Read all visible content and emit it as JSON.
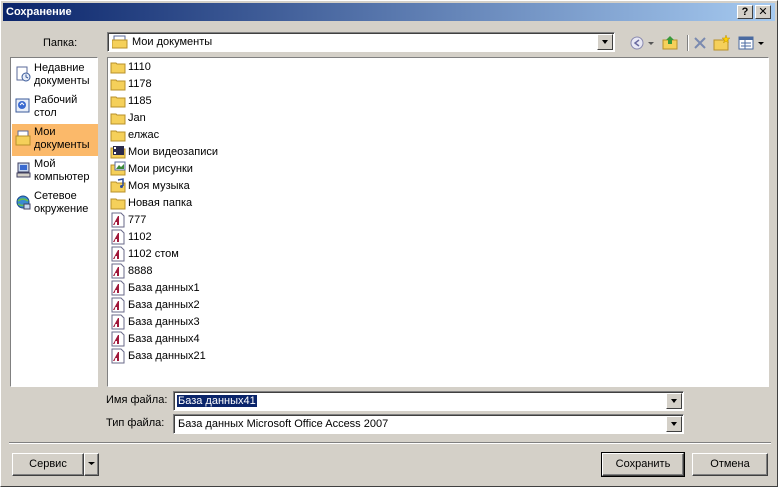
{
  "window": {
    "title": "Сохранение",
    "help_label": "?",
    "close_label": "✕"
  },
  "folder": {
    "label": "Папка:",
    "current": "Мои документы"
  },
  "places": [
    {
      "label": "Недавние\nдокументы",
      "icon": "recent-documents-icon",
      "selected": false
    },
    {
      "label": "Рабочий\nстол",
      "icon": "desktop-icon",
      "selected": false
    },
    {
      "label": "Мои\nдокументы",
      "icon": "my-documents-icon",
      "selected": true
    },
    {
      "label": "Мой\nкомпьютер",
      "icon": "my-computer-icon",
      "selected": false
    },
    {
      "label": "Сетевое\nокружение",
      "icon": "network-icon",
      "selected": false
    }
  ],
  "files": [
    {
      "name": "1110",
      "icon": "folder-icon"
    },
    {
      "name": "1178",
      "icon": "folder-icon"
    },
    {
      "name": "1185",
      "icon": "folder-icon"
    },
    {
      "name": "Jan",
      "icon": "folder-icon"
    },
    {
      "name": "елжас",
      "icon": "folder-icon"
    },
    {
      "name": "Мои видеозаписи",
      "icon": "video-folder-icon"
    },
    {
      "name": "Мои рисунки",
      "icon": "pictures-folder-icon"
    },
    {
      "name": "Моя музыка",
      "icon": "music-folder-icon"
    },
    {
      "name": "Новая папка",
      "icon": "folder-icon"
    },
    {
      "name": "777",
      "icon": "access-db-icon"
    },
    {
      "name": "1102",
      "icon": "access-db-icon"
    },
    {
      "name": "1102 стом",
      "icon": "access-db-icon"
    },
    {
      "name": "8888",
      "icon": "access-db-icon"
    },
    {
      "name": "База данных1",
      "icon": "access-db-icon"
    },
    {
      "name": "База данных2",
      "icon": "access-db-icon"
    },
    {
      "name": "База данных3",
      "icon": "access-db-icon"
    },
    {
      "name": "База данных4",
      "icon": "access-db-icon"
    },
    {
      "name": "База данных21",
      "icon": "access-db-icon"
    }
  ],
  "filename": {
    "label": "Имя файла:",
    "value": "База данных41"
  },
  "filetype": {
    "label": "Тип файла:",
    "value": "База данных Microsoft Office Access 2007"
  },
  "buttons": {
    "tools": "Сервис",
    "save": "Сохранить",
    "cancel": "Отмена"
  },
  "colors": {
    "title_start": "#0a246a",
    "title_end": "#a6caf0",
    "selected_place": "#fbb96a",
    "face": "#d4d0c8"
  }
}
